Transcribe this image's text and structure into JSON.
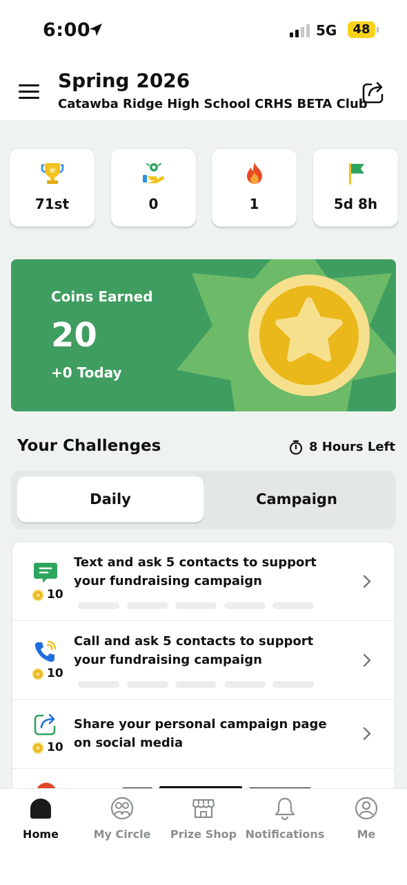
{
  "status_bar": {
    "time": "6:00",
    "network": "5G",
    "battery": "48"
  },
  "header": {
    "title": "Spring 2026",
    "subtitle": "Catawba Ridge High School CRHS BETA Club",
    "menu_icon": "hamburger-icon",
    "share_icon": "share-icon"
  },
  "stats": [
    {
      "icon": "trophy-icon",
      "value": "71st"
    },
    {
      "icon": "donation-hand-icon",
      "value": "0"
    },
    {
      "icon": "flame-icon",
      "value": "1"
    },
    {
      "icon": "flag-icon",
      "value": "5d 8h"
    }
  ],
  "coins": {
    "label": "Coins Earned",
    "value": "20",
    "today": "+0 Today"
  },
  "challenges": {
    "title": "Your Challenges",
    "time_left": "8 Hours Left",
    "tabs": [
      {
        "label": "Daily",
        "selected": true
      },
      {
        "label": "Campaign",
        "selected": false
      }
    ],
    "items": [
      {
        "icon": "chat-icon",
        "points": "10",
        "text": "Text and ask 5 contacts to support your fundraising campaign"
      },
      {
        "icon": "phone-icon",
        "points": "10",
        "text": "Call and ask 5 contacts to support your fundraising campaign"
      },
      {
        "icon": "share-icon",
        "points": "10",
        "text": "Share your personal campaign page on social media"
      }
    ]
  },
  "tabbar": [
    {
      "label": "Home",
      "icon": "home-icon",
      "active": true
    },
    {
      "label": "My Circle",
      "icon": "circle-people-icon",
      "active": false
    },
    {
      "label": "Prize Shop",
      "icon": "shop-icon",
      "active": false
    },
    {
      "label": "Notifications",
      "icon": "bell-icon",
      "active": false
    },
    {
      "label": "Me",
      "icon": "person-icon",
      "active": false
    }
  ],
  "colors": {
    "green": "#3f9d60",
    "gold": "#f2c21d",
    "background": "#eef3f1"
  }
}
